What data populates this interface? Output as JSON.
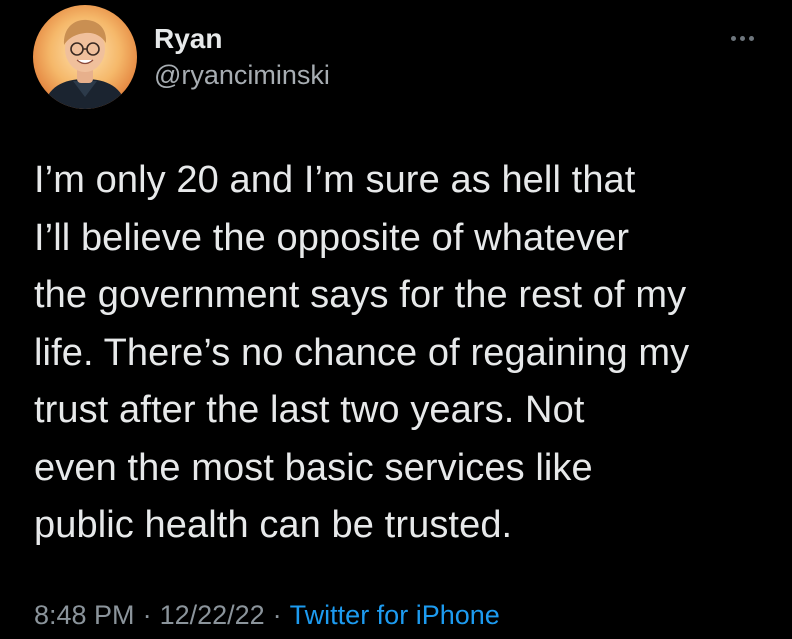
{
  "user": {
    "display_name": "Ryan",
    "handle": "@ryanciminski"
  },
  "more_icon": "more-horizontal-icon",
  "tweet": {
    "text": "I’m only 20 and I’m sure as hell that\nI’ll believe the opposite of whatever\nthe government says for the rest of my\nlife. There’s no chance of regaining my\ntrust after the last two years. Not\neven the most basic services like\npublic health can be trusted."
  },
  "meta": {
    "time": "8:48 PM",
    "separator": "·",
    "date": "12/22/22",
    "source": "Twitter for iPhone"
  },
  "colors": {
    "background": "#000000",
    "text": "#e7e9ea",
    "secondary_text": "#8b949b",
    "link": "#1d9bf0"
  }
}
